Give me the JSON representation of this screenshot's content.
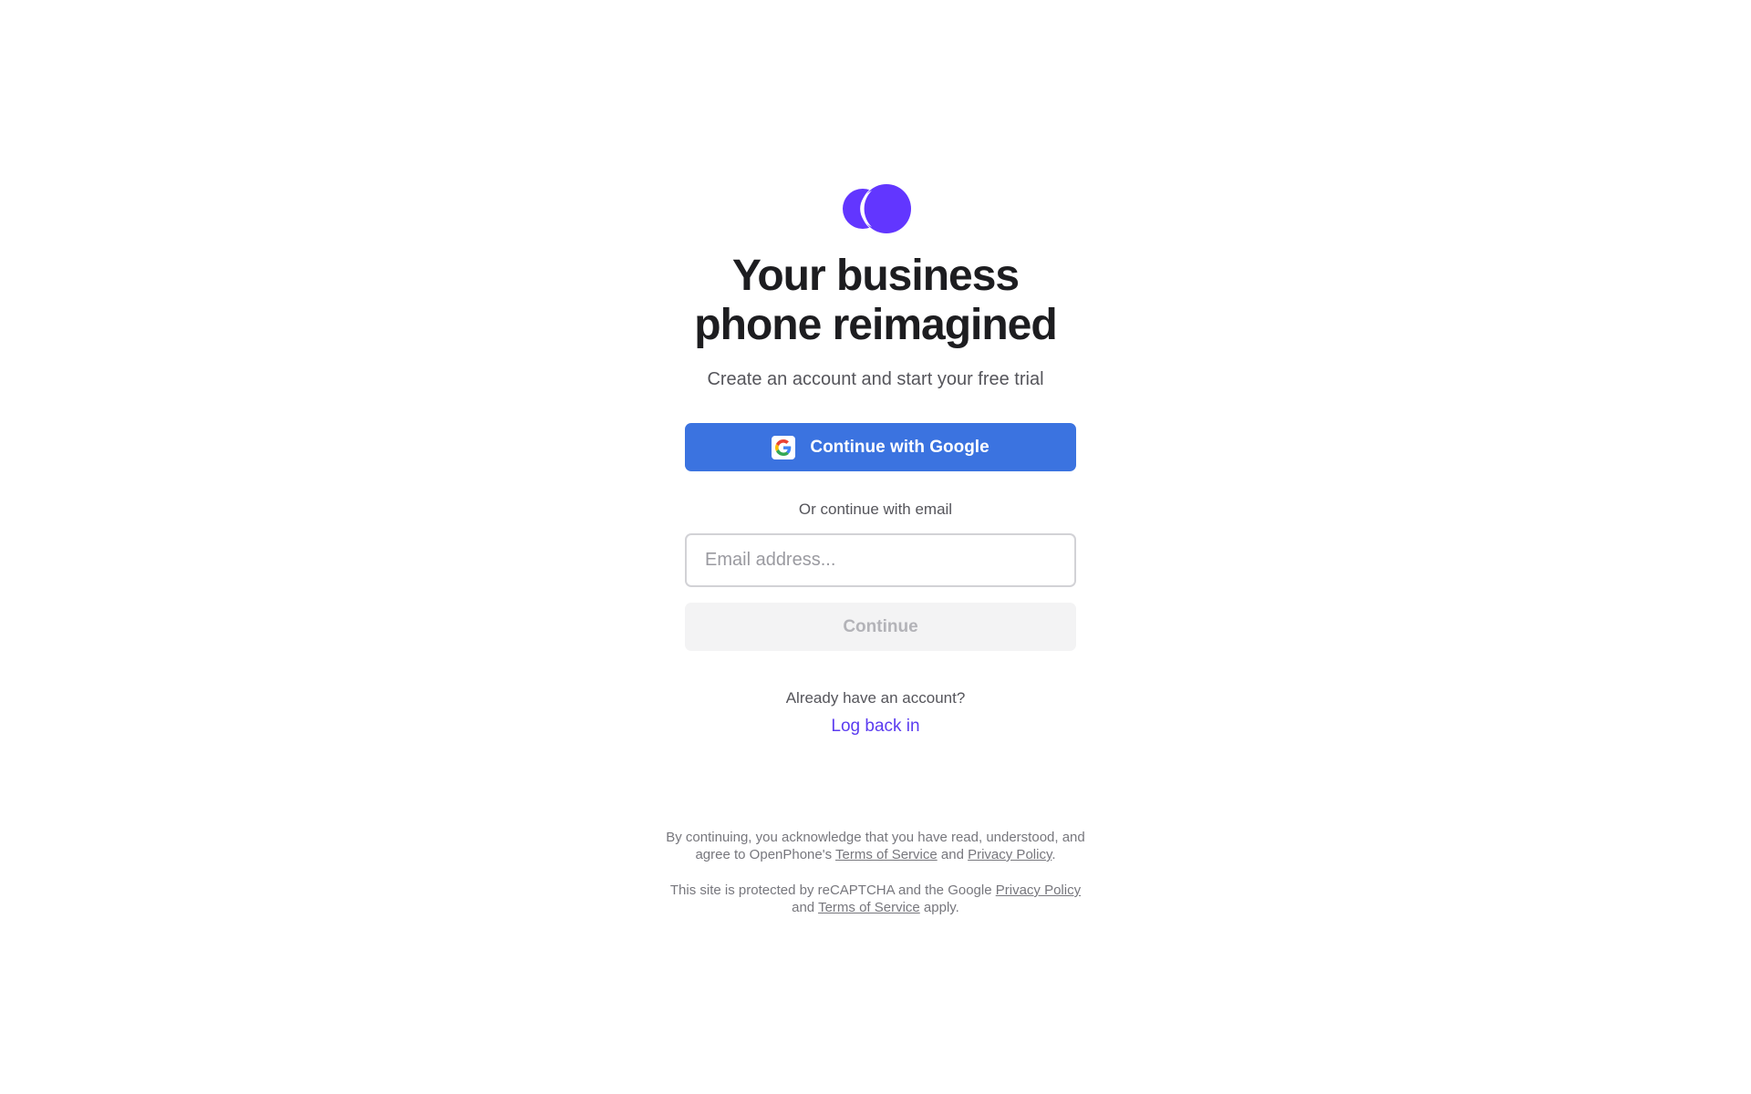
{
  "brand": {
    "logo_icon": "overlapping-circles-logo",
    "accent_color": "#6236ff"
  },
  "headline": {
    "line1": "Your business",
    "line2": "phone reimagined"
  },
  "subtitle": "Create an account and start your free trial",
  "google_button": {
    "label": "Continue with Google",
    "icon": "google-g-icon",
    "color": "#3b73e0"
  },
  "email_section": {
    "divider_text": "Or continue with email",
    "input_placeholder": "Email address...",
    "input_value": "",
    "continue_label": "Continue"
  },
  "login": {
    "prompt": "Already have an account?",
    "link_label": "Log back in"
  },
  "legal": {
    "p1_a": "By continuing, you acknowledge that you have read, understood, and",
    "p1_b": "agree to OpenPhone's ",
    "p1_tos": "Terms of Service",
    "p1_and": " and ",
    "p1_privacy": "Privacy Policy",
    "p1_end": ".",
    "p2_a": "This site is protected by reCAPTCHA and the Google ",
    "p2_privacy": "Privacy Policy",
    "p2_b": "and ",
    "p2_tos": "Terms of Service",
    "p2_end": " apply."
  }
}
